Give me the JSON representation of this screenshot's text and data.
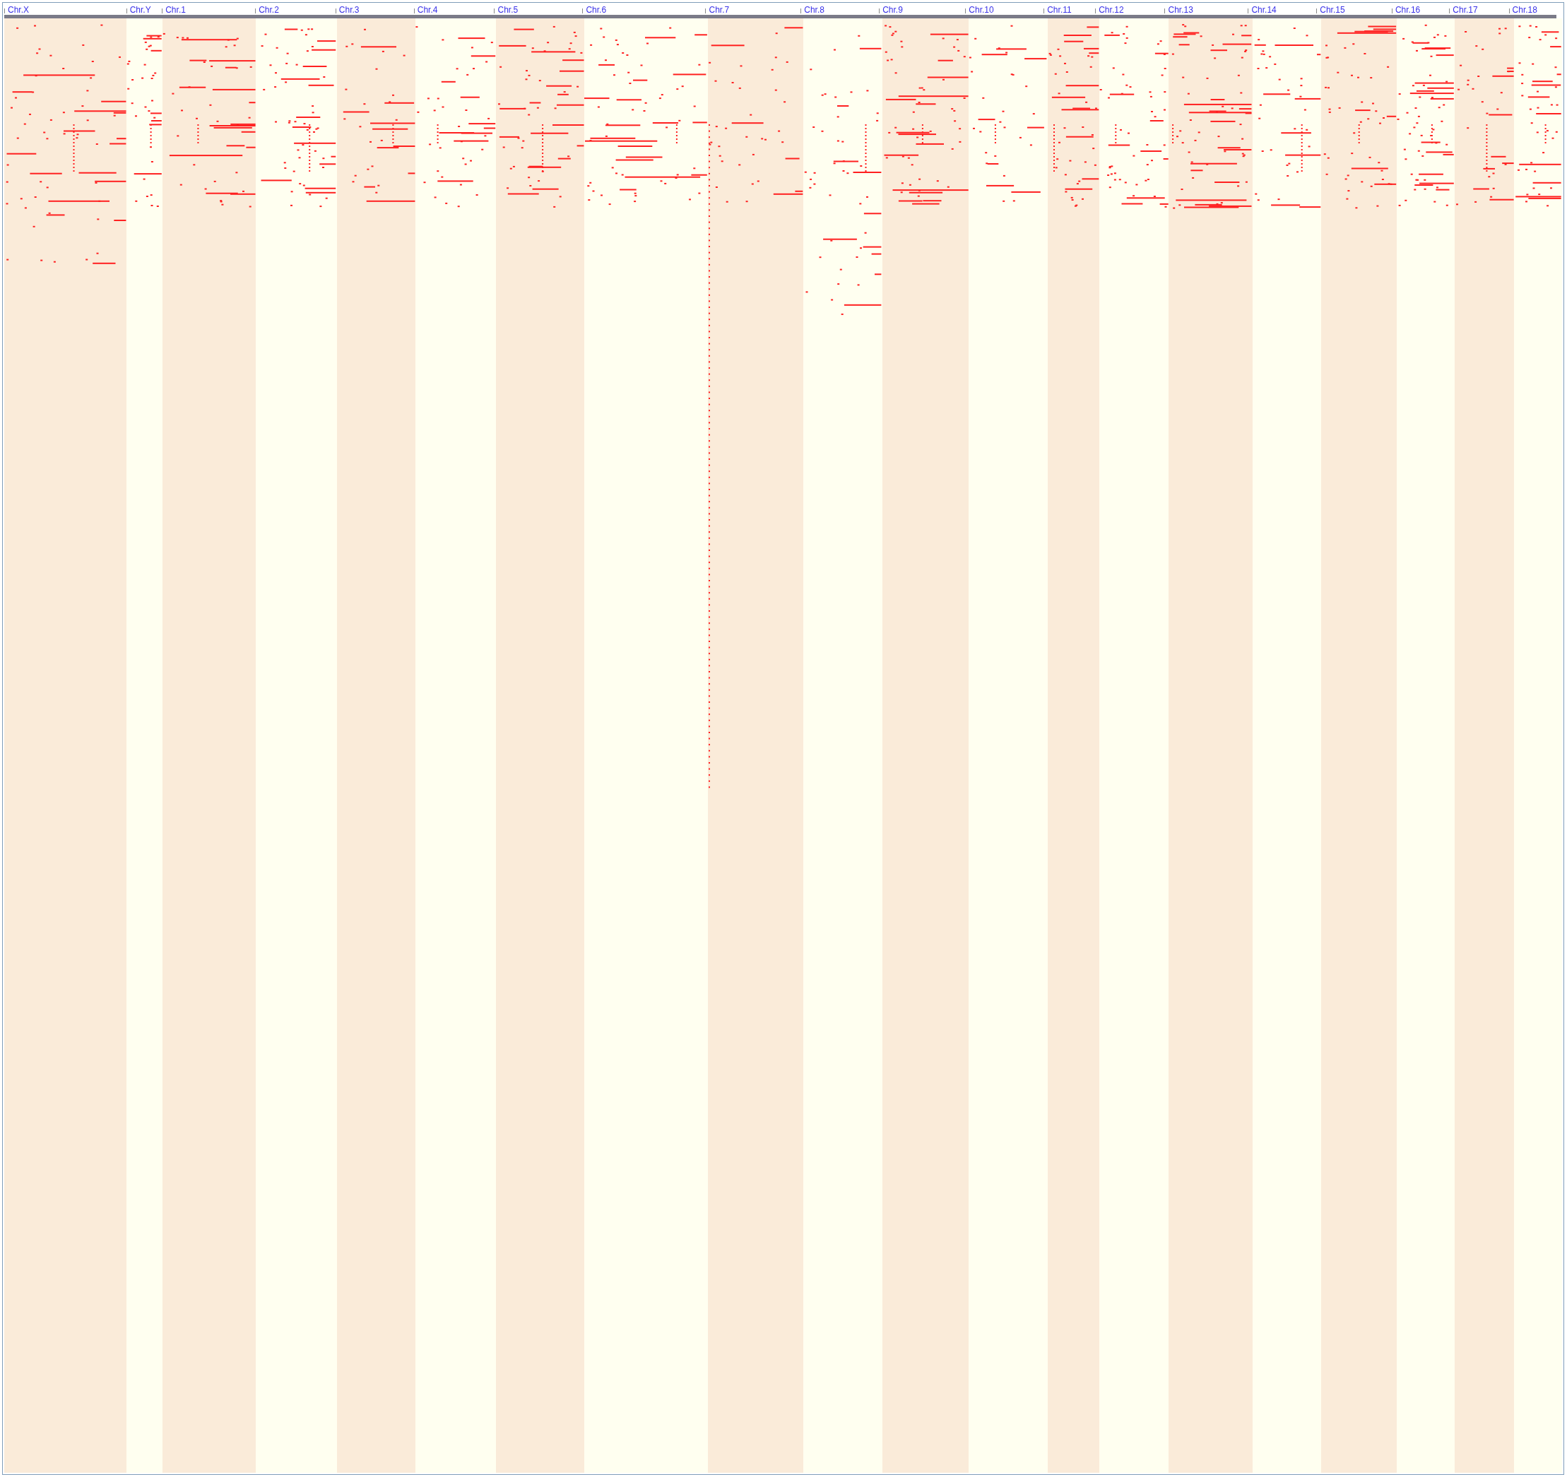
{
  "chromosomes": [
    {
      "label": "Chr.X"
    },
    {
      "label": "Chr.Y"
    },
    {
      "label": "Chr.1"
    },
    {
      "label": "Chr.2"
    },
    {
      "label": "Chr.3"
    },
    {
      "label": "Chr.4"
    },
    {
      "label": "Chr.5"
    },
    {
      "label": "Chr.6"
    },
    {
      "label": "Chr.7"
    },
    {
      "label": "Chr.8"
    },
    {
      "label": "Chr.9"
    },
    {
      "label": "Chr.10"
    },
    {
      "label": "Chr.11"
    },
    {
      "label": "Chr.12"
    },
    {
      "label": "Chr.13"
    },
    {
      "label": "Chr.14"
    },
    {
      "label": "Chr.15"
    },
    {
      "label": "Chr.16"
    },
    {
      "label": "Chr.17"
    },
    {
      "label": "Chr.18"
    }
  ]
}
